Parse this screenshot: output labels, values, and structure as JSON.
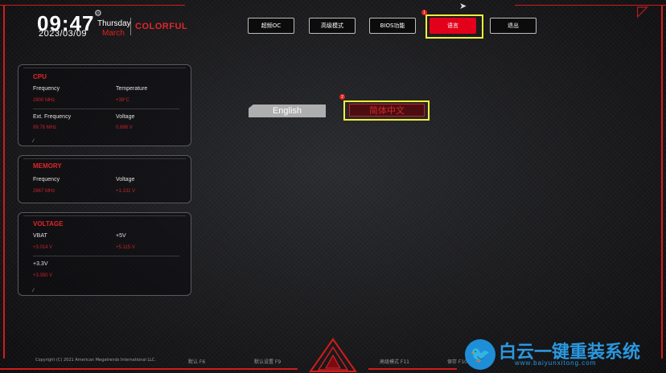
{
  "header": {
    "time": "09:47",
    "date": "2023/03/09",
    "weekday": "Thursday",
    "month": "March",
    "logo": "COLORFUL"
  },
  "nav": {
    "items": [
      {
        "label": "超频OC"
      },
      {
        "label": "高级模式"
      },
      {
        "label": "BIOS功能"
      },
      {
        "label": "语言"
      },
      {
        "label": "退出"
      }
    ],
    "marker1": "1",
    "marker2": "2"
  },
  "cpu": {
    "title": "CPU",
    "frequency_label": "Frequency",
    "frequency_value": "2800 MHz",
    "temperature_label": "Temperature",
    "temperature_value": "+38°C",
    "ext_frequency_label": "Ext. Frequency",
    "ext_frequency_value": "99.78 MHz",
    "voltage_label": "Voltage",
    "voltage_value": "0.898 V"
  },
  "memory": {
    "title": "MEMORY",
    "frequency_label": "Frequency",
    "frequency_value": "2667 MHz",
    "voltage_label": "Voltage",
    "voltage_value": "+1.131 V"
  },
  "voltage": {
    "title": "VOLTAGE",
    "vbat_label": "VBAT",
    "vbat_value": "+3.014 V",
    "v5_label": "+5V",
    "v5_value": "+5.115 V",
    "v33_label": "+3.3V",
    "v33_value": "+3.350 V"
  },
  "language": {
    "english": "English",
    "chinese": "简体中文"
  },
  "footer": {
    "copyright": "Copyright (C) 2021 American Megatrends International LLC.",
    "defaults": "默认 F6",
    "load_defaults": "默认设置 F9",
    "advanced": "高级模式 F11",
    "save": "保存 F10"
  },
  "watermark": {
    "text": "白云一键重装系统",
    "url": "www.baiyunxitong.com"
  },
  "colors": {
    "accent": "#e3001b",
    "highlight": "#f2ee3a",
    "value": "#c8232a"
  }
}
